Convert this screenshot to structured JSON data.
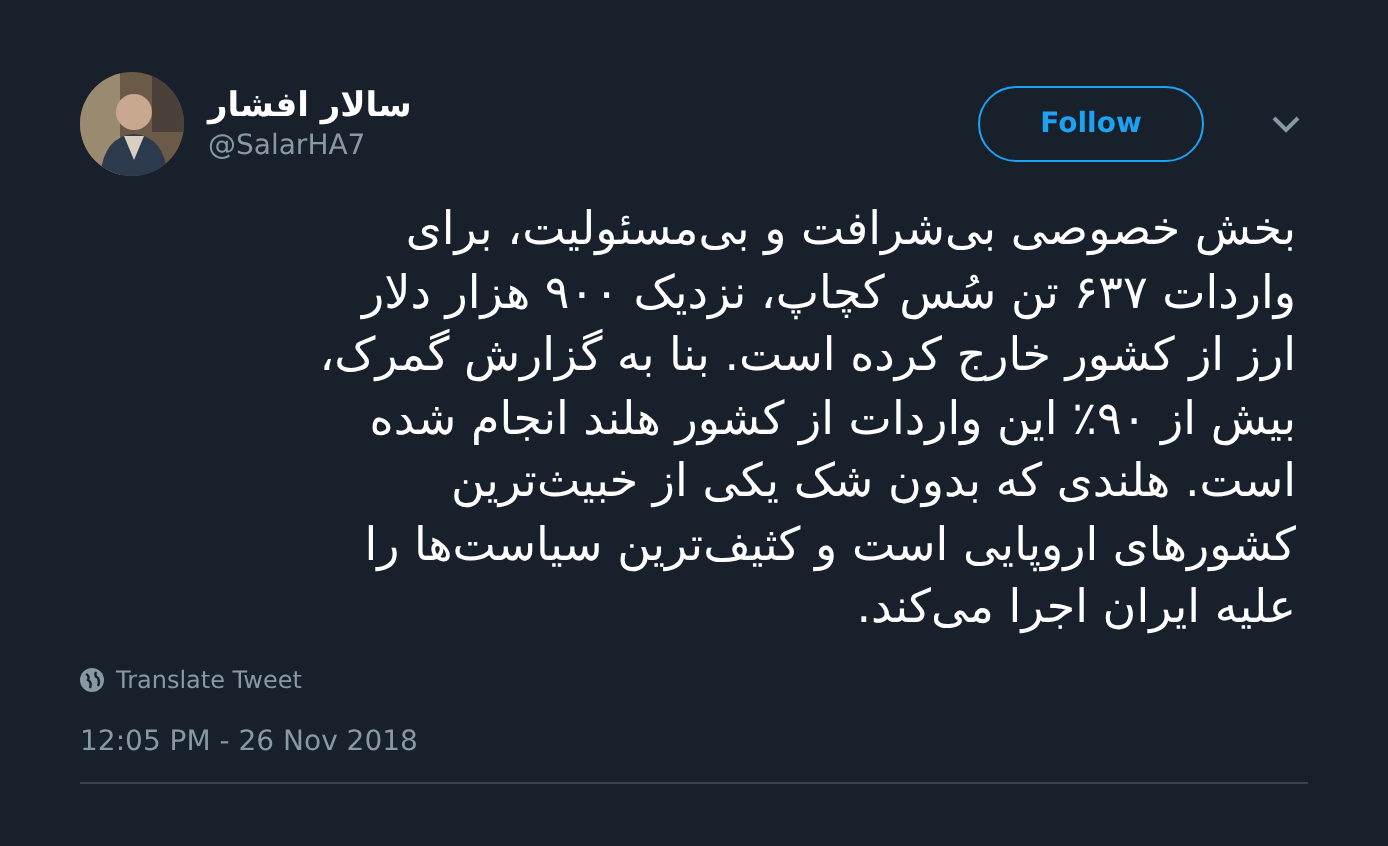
{
  "author": {
    "name": "سالار افشار",
    "handle": "@SalarHA7"
  },
  "follow_button": {
    "label": "Follow"
  },
  "tweet": {
    "text": "بخش خصوصی بی‌شرافت و بی‌مسئولیت، برای\nواردات ۶۳۷ تن سُس کچاپ، نزدیک ۹۰۰ هزار دلار\nارز از کشور خارج کرده است. بنا به گزارش گمرک،\nبیش از ۹۰٪ این واردات از کشور هلند انجام شده\nاست. هلندی که بدون شک یکی از خبیث‌ترین\nکشورهای اروپایی است و کثیف‌ترین سیاست‌ها را\nعلیه ایران اجرا می‌کند."
  },
  "translate_link": "Translate Tweet",
  "timestamp": "12:05 PM - 26 Nov 2018"
}
